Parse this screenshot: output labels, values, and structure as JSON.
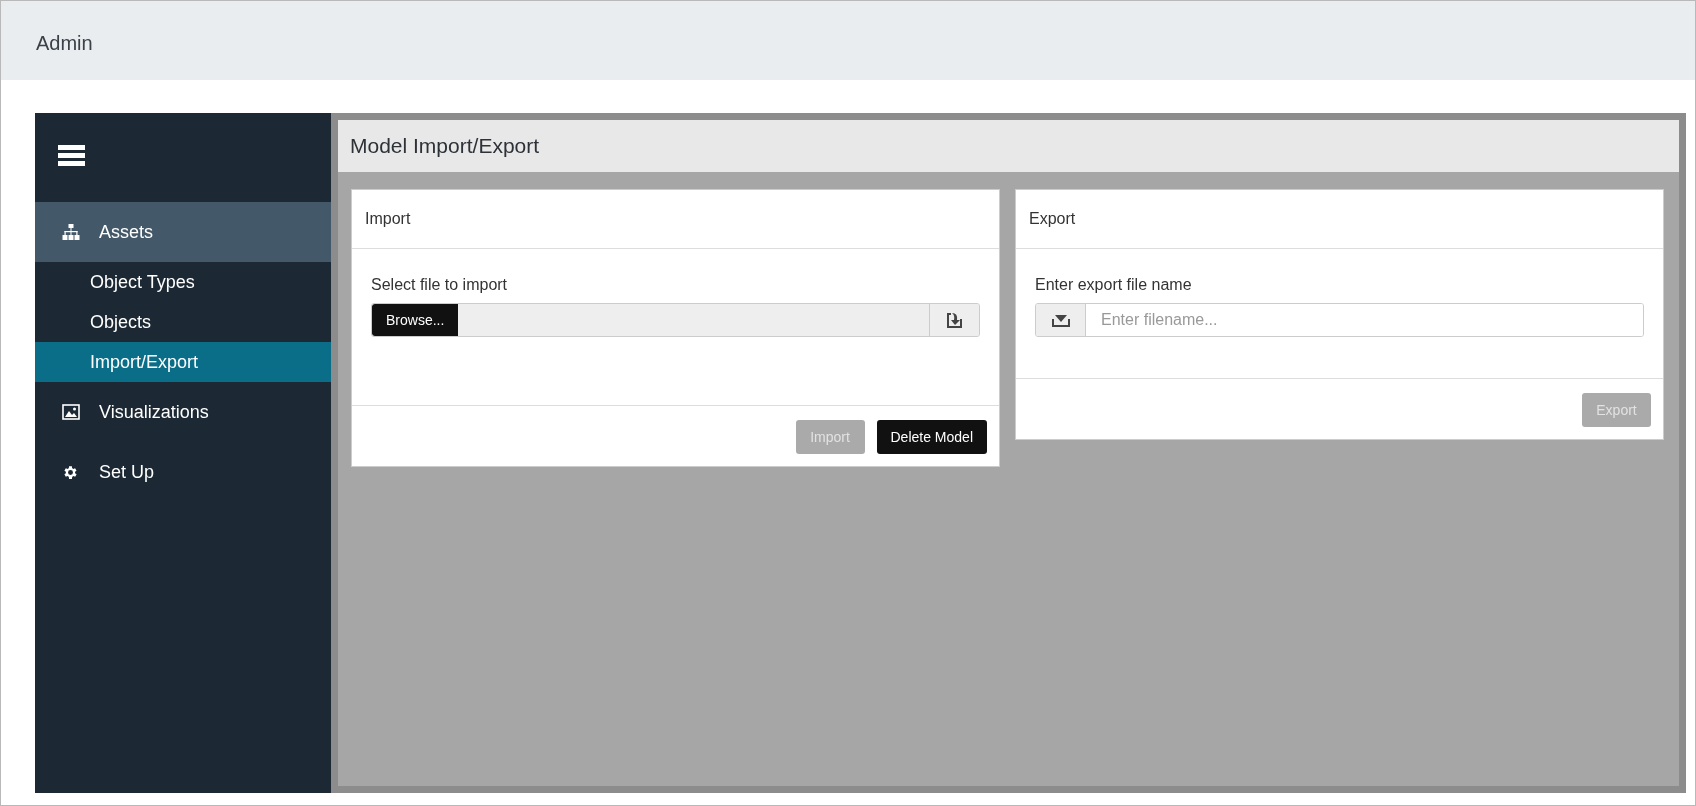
{
  "header": {
    "title": "Admin"
  },
  "sidebar": {
    "items": [
      {
        "label": "Assets",
        "kind": "hierarchy",
        "expanded": true,
        "children": [
          {
            "label": "Object Types",
            "selected": false
          },
          {
            "label": "Objects",
            "selected": false
          },
          {
            "label": "Import/Export",
            "selected": true
          }
        ]
      },
      {
        "label": "Visualizations",
        "kind": "image",
        "expanded": false
      },
      {
        "label": "Set Up",
        "kind": "gear",
        "expanded": false
      }
    ]
  },
  "page": {
    "title": "Model Import/Export"
  },
  "cards": [
    {
      "title": "Import",
      "kind": "file",
      "label": "Select file to import",
      "browse_button": "Browse...",
      "buttons": [
        {
          "label": "Import",
          "disabled": true
        },
        {
          "label": "Delete Model",
          "disabled": false
        }
      ]
    },
    {
      "title": "Export",
      "kind": "text",
      "label": "Enter export file name",
      "placeholder": "Enter filename...",
      "buttons": [
        {
          "label": "Export",
          "disabled": true
        }
      ]
    }
  ]
}
